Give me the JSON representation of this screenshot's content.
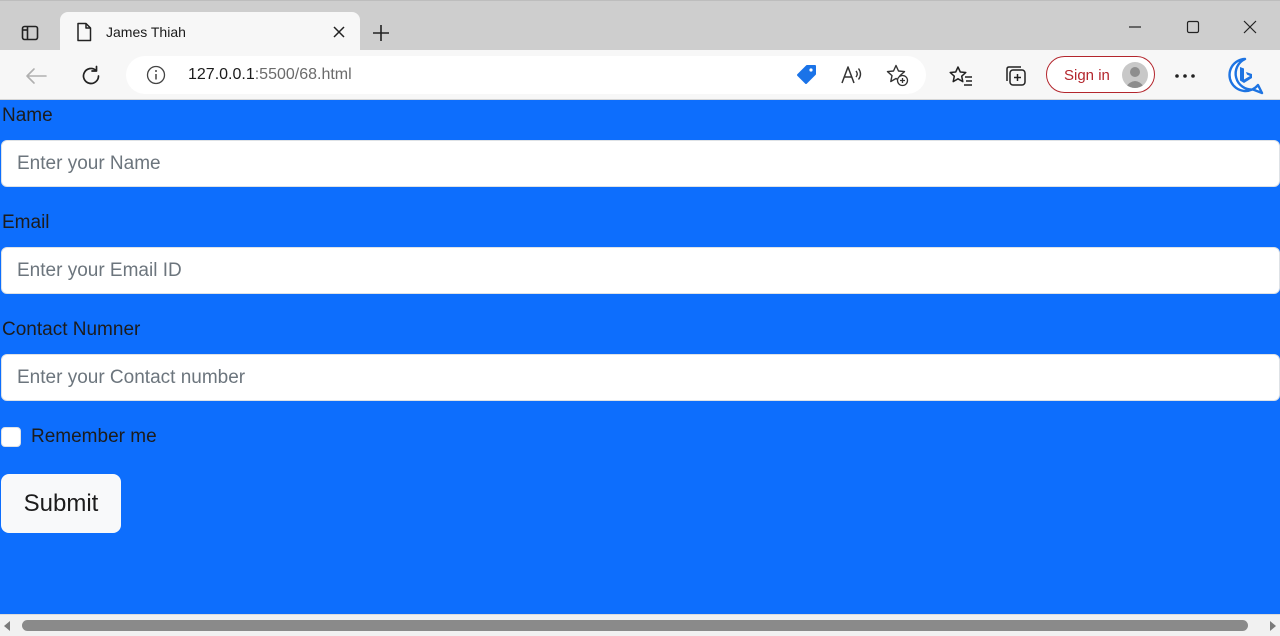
{
  "browser": {
    "tab_title": "James Thiah",
    "url_host": "127.0.0.1",
    "url_rest": ":5500/68.html",
    "signin_label": "Sign in",
    "icons": [
      "tab-actions-icon",
      "document-icon",
      "close-icon",
      "new-tab-icon",
      "minimize-icon",
      "maximize-icon",
      "window-close-icon",
      "back-icon",
      "refresh-icon",
      "info-icon",
      "coupon-tag-icon",
      "read-aloud-icon",
      "add-favorite-icon",
      "favorites-icon",
      "collections-icon",
      "profile-avatar-icon",
      "more-icon",
      "bing-chat-icon"
    ]
  },
  "form": {
    "name_label": "Name",
    "name_placeholder": "Enter your Name",
    "email_label": "Email",
    "email_placeholder": "Enter your Email ID",
    "contact_label": "Contact Numner",
    "contact_placeholder": "Enter your Contact number",
    "remember_label": "Remember me",
    "remember_checked": false,
    "submit_label": "Submit"
  },
  "colors": {
    "page_background": "#0d6efd",
    "signin_accent": "#b3262d",
    "coupon_accent": "#1a73e8"
  }
}
